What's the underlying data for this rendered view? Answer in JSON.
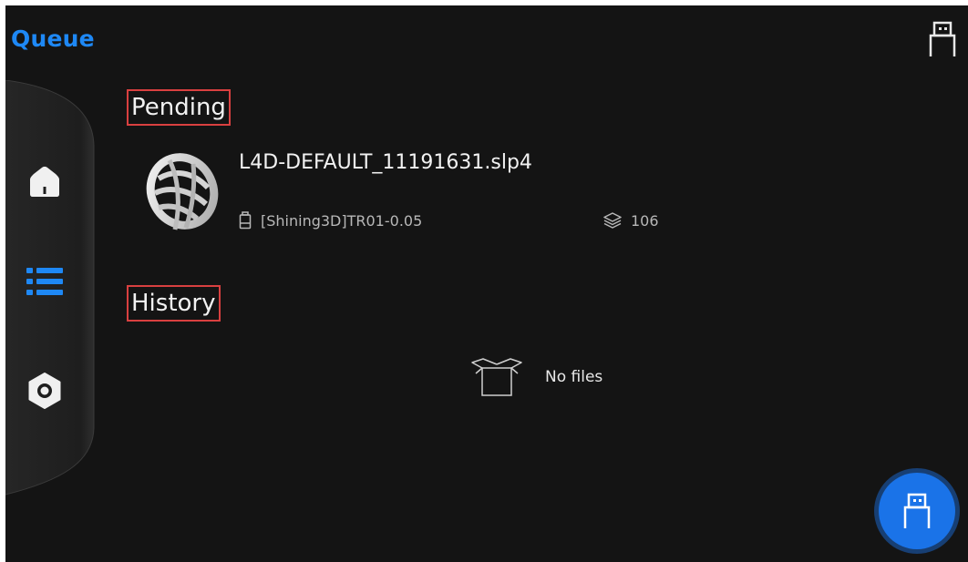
{
  "app": {
    "title": "Queue"
  },
  "colors": {
    "accent": "#1e88f5",
    "background": "#141414",
    "highlight_border": "#d94040",
    "fab": "#1a73e8"
  },
  "sidebar": {
    "items": [
      {
        "name": "home",
        "icon": "home-icon",
        "active": false
      },
      {
        "name": "queue",
        "icon": "list-icon",
        "active": true
      },
      {
        "name": "settings",
        "icon": "settings-icon",
        "active": false
      }
    ]
  },
  "pending": {
    "heading": "Pending",
    "items": [
      {
        "filename": "L4D-DEFAULT_11191631.slp4",
        "profile": "[Shining3D]TR01-0.05",
        "layers": "106",
        "thumbnail_icon": "model-thumbnail"
      }
    ]
  },
  "history": {
    "heading": "History",
    "empty_text": "No files",
    "empty_icon": "empty-box-icon"
  },
  "top_right": {
    "icon": "usb-icon"
  },
  "fab": {
    "icon": "usb-icon"
  }
}
